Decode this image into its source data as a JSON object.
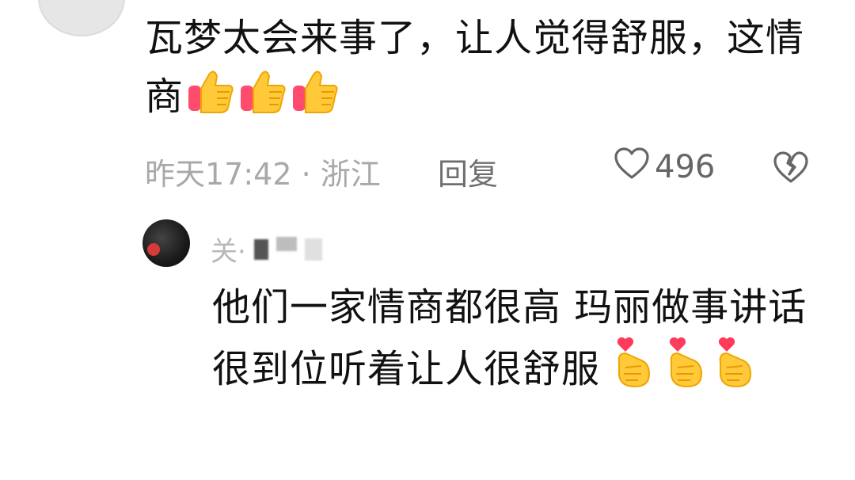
{
  "comment": {
    "text": "瓦梦太会来事了，让人觉得舒服，这情商",
    "emoji": "thumbs-up-icon",
    "emoji_count": 3,
    "time_location": "昨天17:42 · 浙江",
    "reply_label": "回复",
    "like_count": "496"
  },
  "reply": {
    "username": "关·",
    "text": "他们一家情商都很高 玛丽做事讲话很到位听着让人很舒服",
    "emoji": "finger-heart-icon",
    "emoji_count": 3
  }
}
